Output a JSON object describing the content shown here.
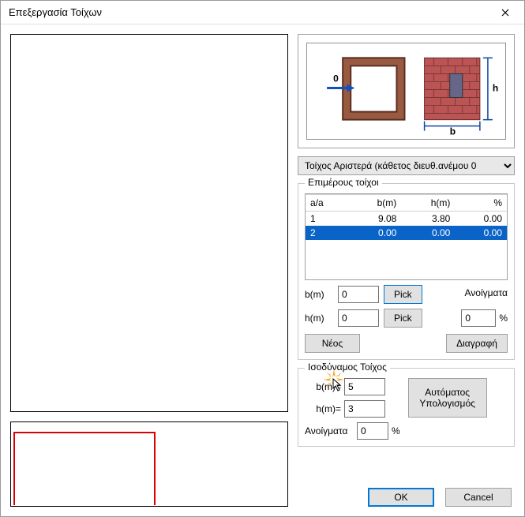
{
  "window": {
    "title": "Επεξεργασία Τοίχων"
  },
  "dropdown": {
    "selected": "Τοίχος Αριστερά (κάθετος διευθ.ανέμου 0"
  },
  "subwalls": {
    "group_title": "Επιμέρους τοίχοι",
    "headers": [
      "a/a",
      "b(m)",
      "h(m)",
      "%"
    ],
    "rows": [
      {
        "id": "1",
        "b": "9.08",
        "h": "3.80",
        "pct": "0.00",
        "selected": false
      },
      {
        "id": "2",
        "b": "0.00",
        "h": "0.00",
        "pct": "0.00",
        "selected": true
      }
    ],
    "bm_label": "b(m)",
    "hm_label": "h(m)",
    "bm_value": "0",
    "hm_value": "0",
    "pick_label": "Pick",
    "openings_label": "Ανοίγματα",
    "openings_value": "0",
    "openings_pct": "%",
    "new_label": "Νέος",
    "delete_label": "Διαγραφή"
  },
  "eq": {
    "group_title": "Ισοδύναμος Τοίχος",
    "bm_label": "b(m)=",
    "bm_value": "5",
    "hm_label": "h(m)=",
    "hm_value": "3",
    "openings_label": "Ανοίγματα",
    "openings_value": "0",
    "openings_pct": "%",
    "auto_label": "Αυτόματος Υπολογισμός"
  },
  "buttons": {
    "ok": "OK",
    "cancel": "Cancel"
  },
  "diagram": {
    "arrow_label": "0",
    "b_label": "b",
    "h_label": "h"
  }
}
